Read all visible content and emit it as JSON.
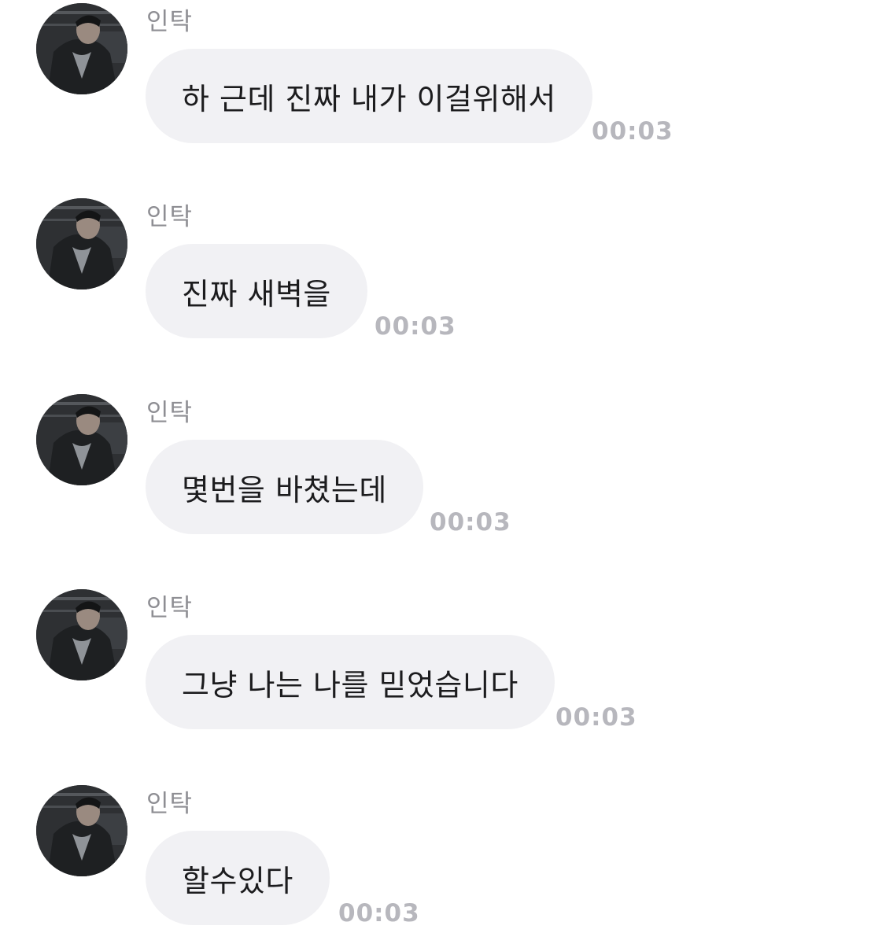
{
  "conversation": {
    "messages": [
      {
        "sender": "인탁",
        "text": "하 근데 진짜 내가 이걸위해서",
        "time": "00:03",
        "avatar_icon": "profile-photo"
      },
      {
        "sender": "인탁",
        "text": "진짜 새벽을",
        "time": "00:03",
        "avatar_icon": "profile-photo"
      },
      {
        "sender": "인탁",
        "text": "몇번을 바쳤는데",
        "time": "00:03",
        "avatar_icon": "profile-photo"
      },
      {
        "sender": "인탁",
        "text": "그냥 나는 나를 믿었습니다",
        "time": "00:03",
        "avatar_icon": "profile-photo"
      },
      {
        "sender": "인탁",
        "text": "할수있다",
        "time": "00:03",
        "avatar_icon": "profile-photo"
      }
    ]
  },
  "colors": {
    "background": "#ffffff",
    "bubble": "#f1f1f4",
    "message_text": "#1c1c1e",
    "sender_name": "#8e8e93",
    "timestamp": "#b7b7bd"
  }
}
